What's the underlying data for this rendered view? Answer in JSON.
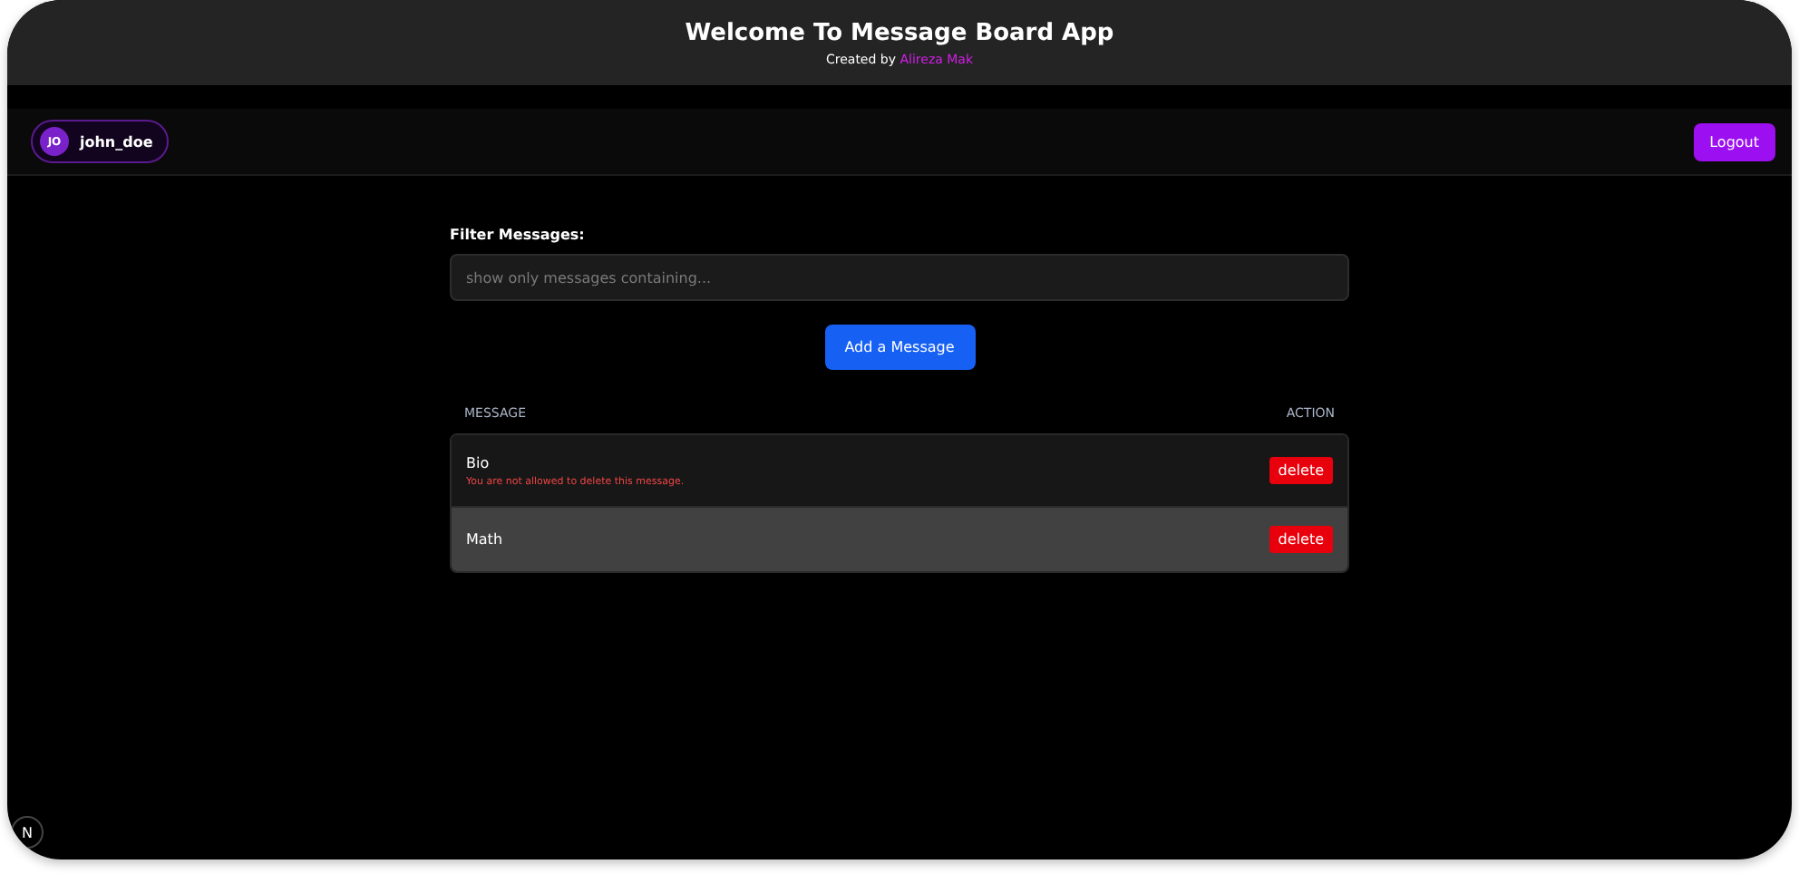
{
  "header": {
    "title": "Welcome To Message Board App",
    "credit_prefix": "Created by",
    "credit_author": "Alireza Mak"
  },
  "user": {
    "initials": "JO",
    "name": "john_doe"
  },
  "logout": "Logout",
  "filter": {
    "label": "Filter Messages:",
    "placeholder": "show only messages containing..."
  },
  "add_button": "Add a Message",
  "table": {
    "columns": [
      "MESSAGE",
      "ACTION"
    ],
    "rows": [
      {
        "message": "Bio",
        "error": "You are not allowed to delete this message.",
        "action": "delete",
        "selected": false
      },
      {
        "message": "Math",
        "action": "delete",
        "selected": true
      }
    ]
  },
  "dev_badge": "N"
}
